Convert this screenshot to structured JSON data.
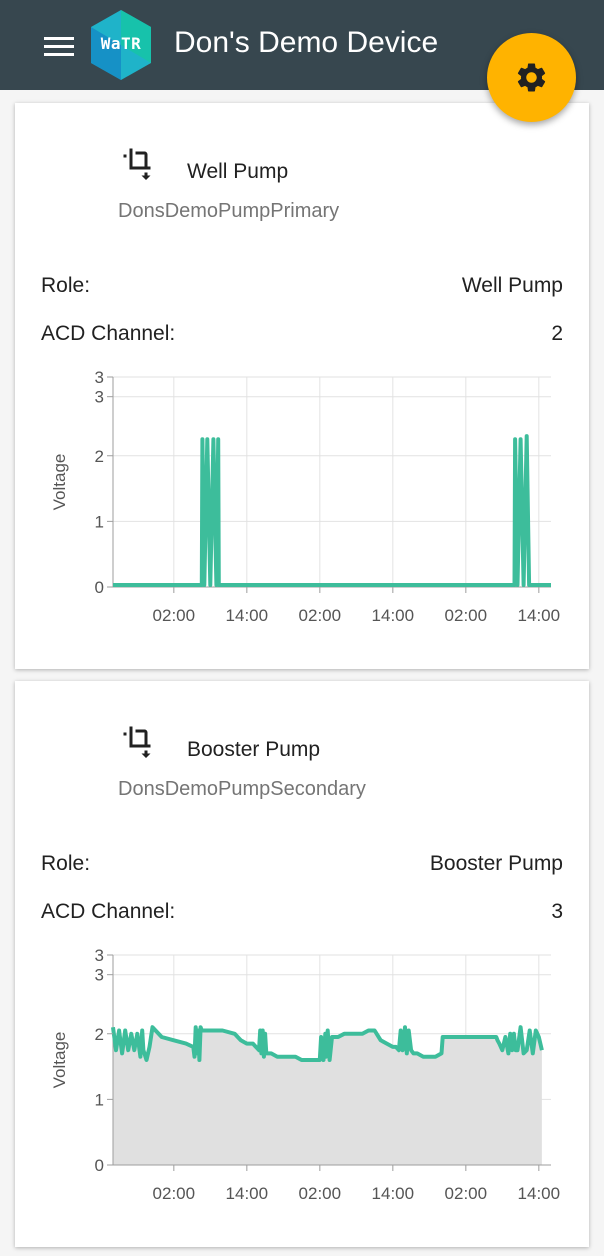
{
  "header": {
    "title": "Don's Demo Device",
    "logo_text": "WaTR",
    "menu_icon": "menu-icon",
    "settings_icon": "gear-icon",
    "bar_color": "#37474f",
    "fab_color": "#ffb300"
  },
  "cards": [
    {
      "title": "Well Pump",
      "subtitle": "DonsDemoPumpPrimary",
      "icon": "crop-rotate-icon",
      "role_label": "Role:",
      "role_value": "Well Pump",
      "channel_label": "ACD Channel:",
      "channel_value": "2"
    },
    {
      "title": "Booster Pump",
      "subtitle": "DonsDemoPumpSecondary",
      "icon": "crop-rotate-icon",
      "role_label": "Role:",
      "role_value": "Booster Pump",
      "channel_label": "ACD Channel:",
      "channel_value": "3"
    }
  ],
  "chart_data": [
    {
      "type": "line",
      "ylabel": "Voltage",
      "xlabel": "",
      "ylim": [
        0,
        3.2
      ],
      "xlim": [
        -8,
        64
      ],
      "y_ticks": [
        0,
        1,
        2,
        3,
        3
      ],
      "y_tick_values": [
        0,
        1,
        2,
        2.9,
        3.2
      ],
      "x_ticks": [
        "02:00",
        "14:00",
        "02:00",
        "14:00",
        "02:00",
        "14:00"
      ],
      "x_tick_values": [
        2,
        14,
        26,
        38,
        50,
        62
      ],
      "grid": true,
      "line_color": "#3dbd9b",
      "fill": false,
      "series": [
        {
          "x": [
            -8,
            6.6,
            6.7,
            7.0,
            7.5,
            8.0,
            8.5,
            9.0,
            9.3,
            9.4,
            58.0,
            58.1,
            58.5,
            59.0,
            59.5,
            60.0,
            60.4,
            60.5,
            64
          ],
          "y": [
            0.03,
            0.03,
            2.25,
            0.03,
            2.25,
            0.03,
            2.25,
            0.03,
            2.25,
            0.03,
            0.03,
            2.25,
            0.03,
            2.25,
            0.03,
            2.3,
            0.03,
            0.03,
            0.03
          ]
        }
      ]
    },
    {
      "type": "area",
      "ylabel": "Voltage",
      "xlabel": "",
      "ylim": [
        0,
        3.2
      ],
      "xlim": [
        -8,
        64
      ],
      "y_ticks": [
        0,
        1,
        2,
        3,
        3
      ],
      "y_tick_values": [
        0,
        1,
        2,
        2.9,
        3.2
      ],
      "x_ticks": [
        "02:00",
        "14:00",
        "02:00",
        "14:00",
        "02:00",
        "14:00"
      ],
      "x_tick_values": [
        2,
        14,
        26,
        38,
        50,
        62
      ],
      "grid": true,
      "line_color": "#3dbd9b",
      "fill_color": "#e0e0e0",
      "fill": true,
      "series": [
        {
          "x": [
            -8,
            -7.5,
            -7,
            -6.5,
            -6,
            -5.5,
            -5,
            -4.5,
            -4,
            -3.5,
            -3.2,
            -3,
            -2.5,
            -2,
            -1.5,
            0,
            2,
            4,
            5.2,
            5.4,
            5.6,
            5.8,
            6,
            6.2,
            6.4,
            6.6,
            8,
            10,
            12,
            12.5,
            13,
            14,
            15,
            16,
            16.2,
            16.4,
            16.6,
            16.8,
            17,
            17.2,
            17.5,
            18,
            19,
            20,
            21,
            22,
            23,
            24,
            25,
            26,
            26.2,
            26.6,
            26.9,
            27,
            27.3,
            27.6,
            28,
            29,
            30,
            32,
            33,
            34,
            35,
            36,
            37,
            38,
            38.5,
            39,
            39.3,
            39.6,
            40,
            40.3,
            40.6,
            41,
            41.4,
            42,
            43,
            44,
            45,
            46,
            46.2,
            48,
            50,
            52,
            54,
            55,
            55.2,
            55.5,
            56,
            56.5,
            57,
            57.3,
            57.6,
            57.9,
            58.2,
            58.5,
            59,
            59.5,
            60,
            60.5,
            61,
            61.5,
            62,
            62.5
          ],
          "y": [
            2.1,
            1.75,
            2.05,
            1.7,
            2.05,
            1.75,
            2.0,
            1.75,
            2.0,
            1.65,
            2.05,
            1.75,
            1.6,
            1.8,
            2.1,
            1.95,
            1.9,
            1.85,
            1.8,
            1.65,
            2.1,
            1.7,
            2.05,
            1.6,
            2.1,
            2.05,
            2.05,
            2.05,
            2.0,
            1.95,
            1.9,
            1.85,
            1.85,
            1.75,
            2.05,
            1.7,
            2.05,
            1.65,
            2.0,
            1.7,
            1.7,
            1.7,
            1.65,
            1.65,
            1.65,
            1.65,
            1.6,
            1.6,
            1.6,
            1.6,
            1.95,
            1.6,
            2.0,
            1.65,
            2.05,
            1.6,
            1.95,
            1.95,
            2.0,
            2.0,
            2.0,
            2.05,
            2.05,
            1.9,
            1.85,
            1.8,
            1.8,
            1.75,
            2.05,
            1.75,
            2.1,
            1.7,
            2.05,
            1.75,
            1.7,
            1.7,
            1.65,
            1.65,
            1.65,
            1.7,
            1.95,
            1.95,
            1.95,
            1.95,
            1.95,
            1.95,
            1.9,
            1.85,
            1.75,
            1.95,
            1.7,
            2.0,
            1.75,
            2.0,
            1.75,
            1.75,
            2.1,
            1.7,
            1.75,
            2.05,
            1.7,
            2.05,
            1.95,
            1.75
          ]
        }
      ]
    }
  ]
}
